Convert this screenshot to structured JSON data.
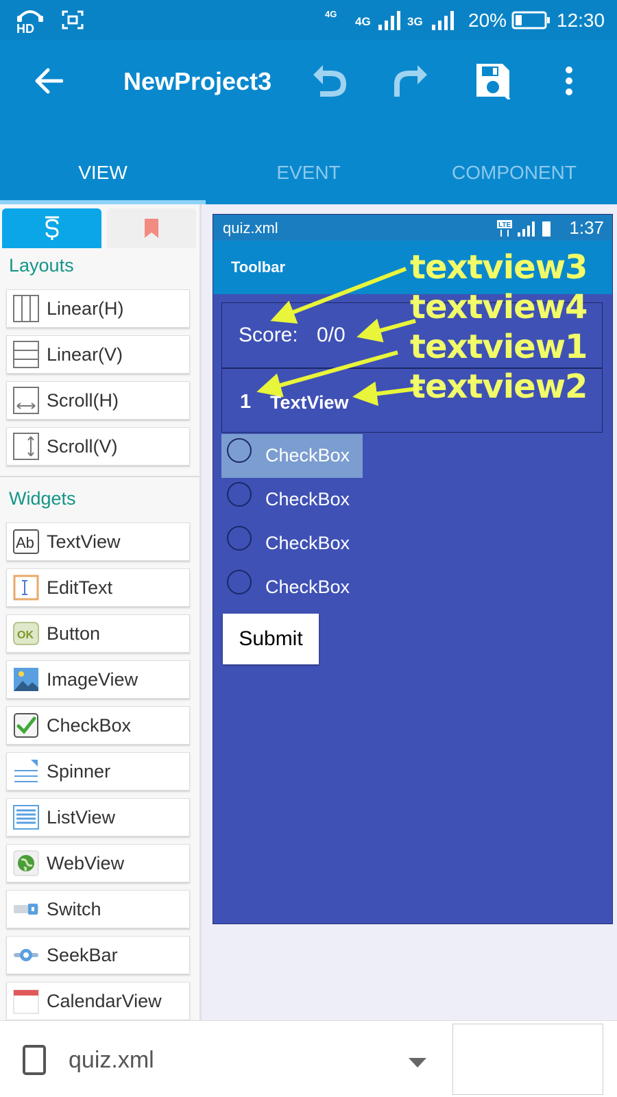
{
  "status_bar": {
    "hd": "HD",
    "net1": "4G",
    "net2": "4G",
    "net3": "3G",
    "battery": "20%",
    "time": "12:30"
  },
  "app_bar": {
    "title": "NewProject3",
    "icons": [
      "back-arrow-icon",
      "undo-icon",
      "redo-icon",
      "save-icon",
      "more-vert-icon"
    ]
  },
  "tabs": [
    {
      "label": "VIEW",
      "active": true
    },
    {
      "label": "EVENT",
      "active": false
    },
    {
      "label": "COMPONENT",
      "active": false
    }
  ],
  "palette": {
    "tabs": [
      "palette-icon",
      "bookmark-icon"
    ],
    "layouts_heading": "Layouts",
    "layouts": [
      {
        "label": "Linear(H)",
        "icon": "linear-h-icon"
      },
      {
        "label": "Linear(V)",
        "icon": "linear-v-icon"
      },
      {
        "label": "Scroll(H)",
        "icon": "scroll-h-icon"
      },
      {
        "label": "Scroll(V)",
        "icon": "scroll-v-icon"
      }
    ],
    "widgets_heading": "Widgets",
    "widgets": [
      {
        "label": "TextView",
        "icon": "textview-icon"
      },
      {
        "label": "EditText",
        "icon": "edittext-icon"
      },
      {
        "label": "Button",
        "icon": "button-icon"
      },
      {
        "label": "ImageView",
        "icon": "imageview-icon"
      },
      {
        "label": "CheckBox",
        "icon": "checkbox-icon"
      },
      {
        "label": "Spinner",
        "icon": "spinner-icon"
      },
      {
        "label": "ListView",
        "icon": "listview-icon"
      },
      {
        "label": "WebView",
        "icon": "webview-icon"
      },
      {
        "label": "Switch",
        "icon": "switch-icon"
      },
      {
        "label": "SeekBar",
        "icon": "seekbar-icon"
      },
      {
        "label": "CalendarView",
        "icon": "calendarview-icon"
      }
    ]
  },
  "preview": {
    "file": "quiz.xml",
    "time": "1:37",
    "toolbar_title": "Toolbar",
    "score_label": "Score:",
    "score_value": "0/0",
    "question_number": "1",
    "question_text": "TextView",
    "checkboxes": [
      "CheckBox",
      "CheckBox",
      "CheckBox",
      "CheckBox"
    ],
    "submit": "Submit"
  },
  "annotations": [
    "textview3",
    "textview4",
    "textview1",
    "textview2"
  ],
  "annotation_color": "#f2fb68",
  "bottom_bar": {
    "file": "quiz.xml"
  },
  "colors": {
    "primary": "#0a88cd",
    "accent_teal": "#159587",
    "preview_bg": "#3f51b5"
  }
}
